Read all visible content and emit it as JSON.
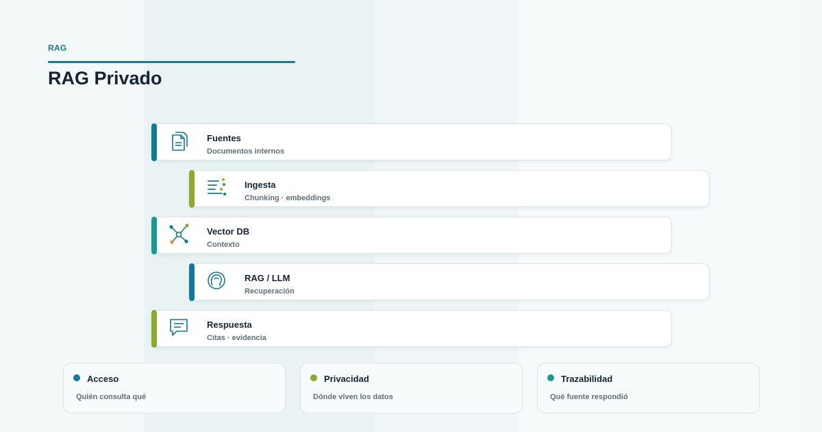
{
  "header": {
    "kicker": "RAG",
    "title": "RAG Privado"
  },
  "steps": [
    {
      "title": "Fuentes",
      "subtitle": "Documentos internos",
      "icon": "documents-icon",
      "accent": "#127a96"
    },
    {
      "title": "Ingesta",
      "subtitle": "Chunking · embeddings",
      "icon": "ingest-lines-icon",
      "accent": "#8aab2a"
    },
    {
      "title": "Vector DB",
      "subtitle": "Contexto",
      "icon": "vector-graph-icon",
      "accent": "#169c8e"
    },
    {
      "title": "RAG / LLM",
      "subtitle": "Recuperación",
      "icon": "llm-head-icon",
      "accent": "#127a96"
    },
    {
      "title": "Respuesta",
      "subtitle": "Citas · evidencia",
      "icon": "chat-bubble-icon",
      "accent": "#8aab2a"
    }
  ],
  "pillars": [
    {
      "title": "Acceso",
      "subtitle": "Quién consulta qué",
      "color": "#127a96"
    },
    {
      "title": "Privacidad",
      "subtitle": "Dónde viven los datos",
      "color": "#8aab2a"
    },
    {
      "title": "Trazabilidad",
      "subtitle": "Qué fuente respondió",
      "color": "#169c8e"
    }
  ]
}
